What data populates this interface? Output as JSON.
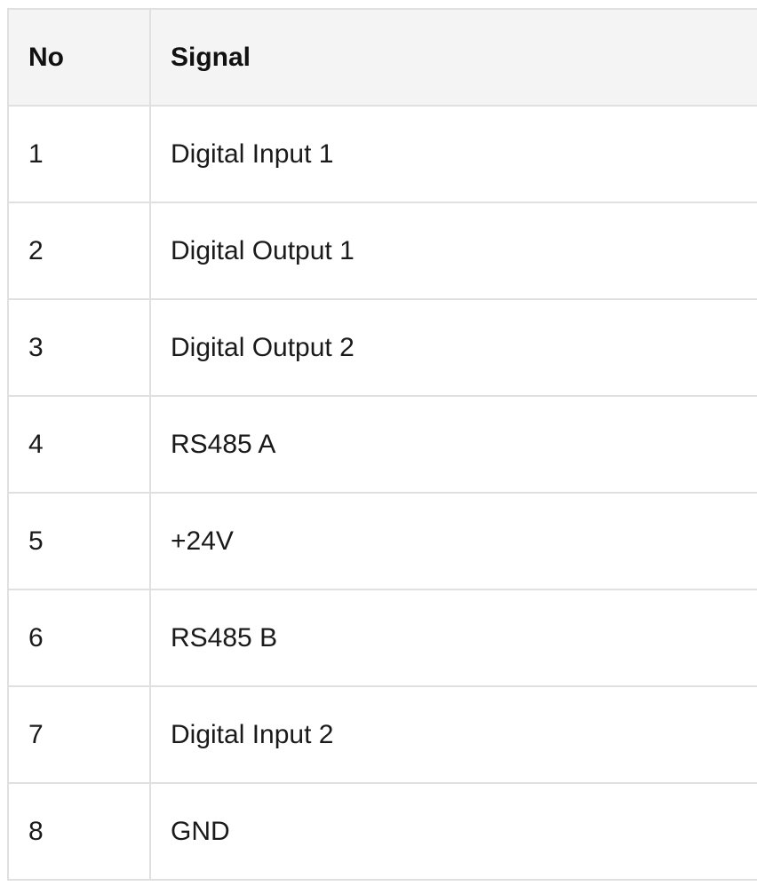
{
  "table": {
    "headers": [
      "No",
      "Signal"
    ],
    "rows": [
      {
        "no": "1",
        "signal": "Digital Input 1"
      },
      {
        "no": "2",
        "signal": "Digital Output 1"
      },
      {
        "no": "3",
        "signal": "Digital Output 2"
      },
      {
        "no": "4",
        "signal": "RS485 A"
      },
      {
        "no": "5",
        "signal": "+24V"
      },
      {
        "no": "6",
        "signal": "RS485 B"
      },
      {
        "no": "7",
        "signal": "Digital Input 2"
      },
      {
        "no": "8",
        "signal": "GND"
      }
    ]
  }
}
